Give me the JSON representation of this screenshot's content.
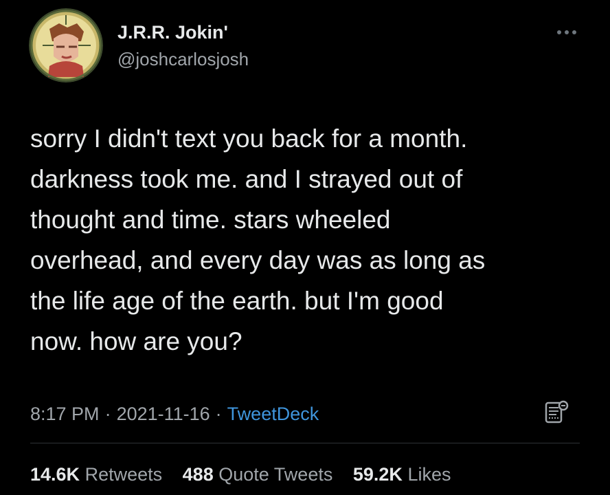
{
  "author": {
    "display_name": "J.R.R. Jokin'",
    "handle": "@joshcarlosjosh",
    "avatar_icon": "stained-glass-portrait-avatar"
  },
  "tweet": {
    "lines": [
      "sorry I didn't text you back for a month.",
      "darkness took me. and I strayed out of",
      "thought and time. stars wheeled",
      "overhead, and every day was as long as",
      "the life age of the earth. but I'm good",
      "now. how are you?"
    ]
  },
  "meta": {
    "time": "8:17 PM",
    "separator": "·",
    "date": "2021-11-16",
    "source": "TweetDeck"
  },
  "stats": {
    "retweets": {
      "count": "14.6K",
      "label": "Retweets"
    },
    "quote_tweets": {
      "count": "488",
      "label": "Quote Tweets"
    },
    "likes": {
      "count": "59.2K",
      "label": "Likes"
    }
  },
  "icons": {
    "more": "more-horizontal-icon",
    "analytics": "analytics-icon"
  },
  "colors": {
    "background": "#000000",
    "text_primary": "#e7e9ea",
    "text_secondary": "#a1a6ab",
    "link": "#3f95dc",
    "divider": "#2f3336"
  }
}
